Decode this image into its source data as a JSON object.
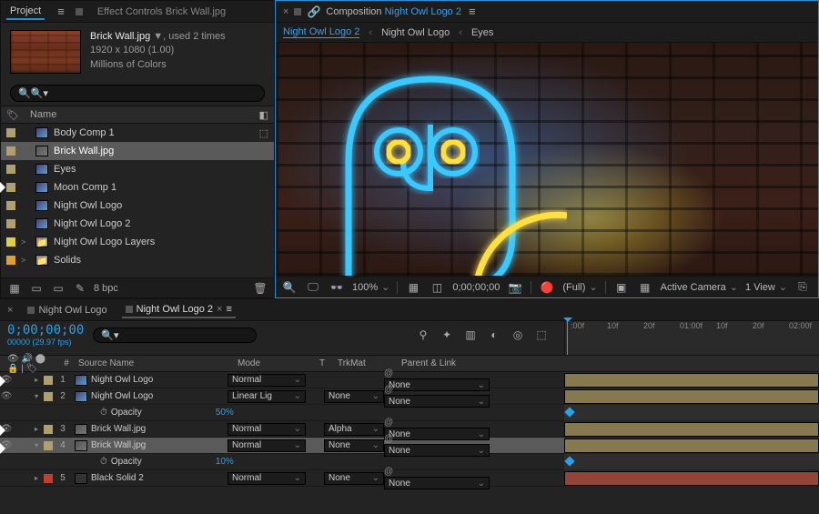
{
  "project": {
    "tab_project": "Project",
    "tab_effect_controls": "Effect Controls Brick Wall.jpg",
    "asset": {
      "name": "Brick Wall.jpg",
      "used": ", used 2 times",
      "dims": "1920 x 1080 (1.00)",
      "colors": "Millions of Colors"
    },
    "search_placeholder": "",
    "header_name": "Name",
    "items": [
      {
        "swatch": "tan",
        "twisty": "",
        "icon": "comp",
        "name": "Body Comp 1"
      },
      {
        "swatch": "tan",
        "twisty": "",
        "icon": "img",
        "name": "Brick Wall.jpg",
        "selected": true
      },
      {
        "swatch": "tan",
        "twisty": "",
        "icon": "comp",
        "name": "Eyes"
      },
      {
        "swatch": "tan",
        "twisty": "",
        "icon": "comp",
        "name": "Moon Comp 1"
      },
      {
        "swatch": "tan",
        "twisty": "",
        "icon": "comp",
        "name": "Night Owl Logo"
      },
      {
        "swatch": "tan",
        "twisty": "",
        "icon": "comp",
        "name": "Night Owl Logo 2"
      },
      {
        "swatch": "yellow",
        "twisty": ">",
        "icon": "folder",
        "name": "Night Owl Logo Layers"
      },
      {
        "swatch": "orange",
        "twisty": ">",
        "icon": "folder",
        "name": "Solids"
      }
    ],
    "footer_bpc": "8 bpc"
  },
  "comp": {
    "title_prefix": "Composition ",
    "title_hl": "Night Owl Logo 2",
    "crumbs": [
      {
        "label": "Night Owl Logo 2",
        "active": true
      },
      {
        "label": "Night Owl Logo",
        "active": false
      },
      {
        "label": "Eyes",
        "active": false
      }
    ],
    "footer": {
      "zoom": "100%",
      "time": "0;00;00;00",
      "res": "(Full)",
      "camera": "Active Camera",
      "view": "1 View"
    }
  },
  "timeline": {
    "tabs": [
      {
        "label": "Night Owl Logo",
        "active": false
      },
      {
        "label": "Night Owl Logo 2",
        "active": true
      }
    ],
    "timecode": "0;00;00;00",
    "fps": "00000 (29.97 fps)",
    "ruler": [
      ":00f",
      "10f",
      "20f",
      "01:00f",
      "10f",
      "20f",
      "02:00f"
    ],
    "header": {
      "num": "#",
      "source": "Source Name",
      "mode": "Mode",
      "t": "T",
      "trkmat": "TrkMat",
      "parent": "Parent & Link"
    },
    "layers": [
      {
        "n": 1,
        "sw": "tan",
        "icon": "comp",
        "name": "Night Owl Logo",
        "mode": "Normal",
        "trk": "",
        "parent": "None",
        "eye": true
      },
      {
        "n": 2,
        "sw": "tan",
        "icon": "comp",
        "name": "Night Owl Logo",
        "mode": "Linear Lig",
        "trk": "None",
        "parent": "None",
        "eye": true,
        "open": true,
        "prop": {
          "name": "Opacity",
          "val": "50%"
        }
      },
      {
        "n": 3,
        "sw": "tan",
        "icon": "img",
        "name": "Brick Wall.jpg",
        "mode": "Normal",
        "trk": "Alpha",
        "parent": "None",
        "eye": true
      },
      {
        "n": 4,
        "sw": "tan",
        "icon": "img",
        "name": "Brick Wall.jpg",
        "mode": "Normal",
        "trk": "None",
        "parent": "None",
        "eye": true,
        "sel": true,
        "open": true,
        "prop": {
          "name": "Opacity",
          "val": "10%"
        }
      },
      {
        "n": 5,
        "sw": "red",
        "icon": "solid",
        "name": "Black Solid 2",
        "mode": "Normal",
        "trk": "None",
        "parent": "None",
        "eye": false
      }
    ]
  }
}
